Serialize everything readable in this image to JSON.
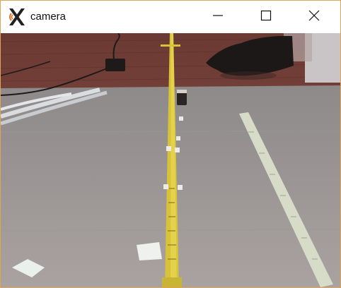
{
  "window": {
    "title": "camera",
    "app_icon": "x-logo-icon",
    "controls": {
      "minimize_icon": "minimize-icon",
      "maximize_icon": "maximize-icon",
      "close_icon": "close-icon"
    },
    "border_color": "#e0a458"
  },
  "viewport": {
    "description_icon": "camera-feed-image"
  }
}
